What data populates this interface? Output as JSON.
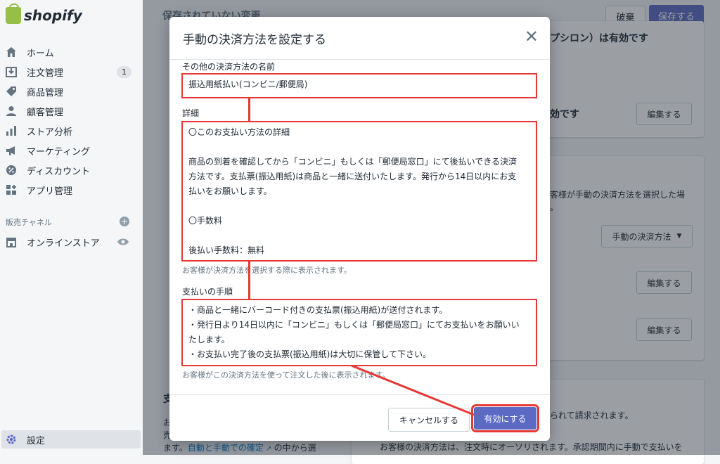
{
  "brand": {
    "name": "shopify"
  },
  "sidebar": {
    "items": [
      {
        "label": "ホーム",
        "icon": "home-icon"
      },
      {
        "label": "注文管理",
        "icon": "orders-icon",
        "badge": "1"
      },
      {
        "label": "商品管理",
        "icon": "tag-icon"
      },
      {
        "label": "顧客管理",
        "icon": "person-icon"
      },
      {
        "label": "ストア分析",
        "icon": "bar-chart-icon"
      },
      {
        "label": "マーケティング",
        "icon": "megaphone-icon"
      },
      {
        "label": "ディスカウント",
        "icon": "discount-icon"
      },
      {
        "label": "アプリ管理",
        "icon": "apps-icon"
      }
    ],
    "channels_label": "販売チャネル",
    "online_store": "オンラインストア",
    "settings": "設定"
  },
  "topbar": {
    "unsaved": "保存されていない変更",
    "discard": "破棄",
    "save": "保存する"
  },
  "background": {
    "text1": "プシロン）は有効です",
    "text2": "効です",
    "edit": "編集する",
    "text3": "客様が手動の決済方法を選択した場",
    "text3b": "。",
    "manual_dropdown": "手動の決済方法",
    "text4": "られて請求されます。",
    "text5": "お客様の決済方法は、注文時にオーソリされます。承認期間内に手動で支払いを",
    "left_heading": "支",
    "left_text1": "お",
    "left_text2": "売",
    "left_text3": "ます。",
    "left_link": "自動と手動での確定",
    "left_text4": "の中から選"
  },
  "modal": {
    "title": "手動の決済方法を設定する",
    "name_label": "その他の決済方法の名前",
    "name_value": "振込用紙払い(コンビニ/郵便局)",
    "details_label": "詳細",
    "details_lines": [
      "〇このお支払い方法の詳細",
      "",
      "商品の到着を確認してから「コンビニ」もしくは「郵便局窓口」にて後払いできる決済",
      "方法です。支払票(振込用紙)は商品と一緒に送付いたします。発行から14日以内にお支",
      "払いをお願いします。",
      "",
      "〇手数料",
      "",
      "後払い手数料：無料"
    ],
    "details_help": "お客様が決済方法を選択する際に表示されます。",
    "instructions_label": "支払いの手順",
    "instructions_lines": [
      "・商品と一緒にバーコード付きの支払票(振込用紙)が送付されます。",
      "・発行日より14日以内に「コンビニ」もしくは「郵便局窓口」にてお支払いをお願いい",
      "たします。",
      "・お支払い完了後の支払票(振込用紙)は大切に保管して下さい。"
    ],
    "instructions_help": "お客様がこの決済方法を使って注文した後に表示されます。",
    "cancel": "キャンセルする",
    "enable": "有効にする"
  },
  "colors": {
    "accent": "#5c6ac4",
    "highlight": "#e53935",
    "brand_green": "#95bf47"
  }
}
